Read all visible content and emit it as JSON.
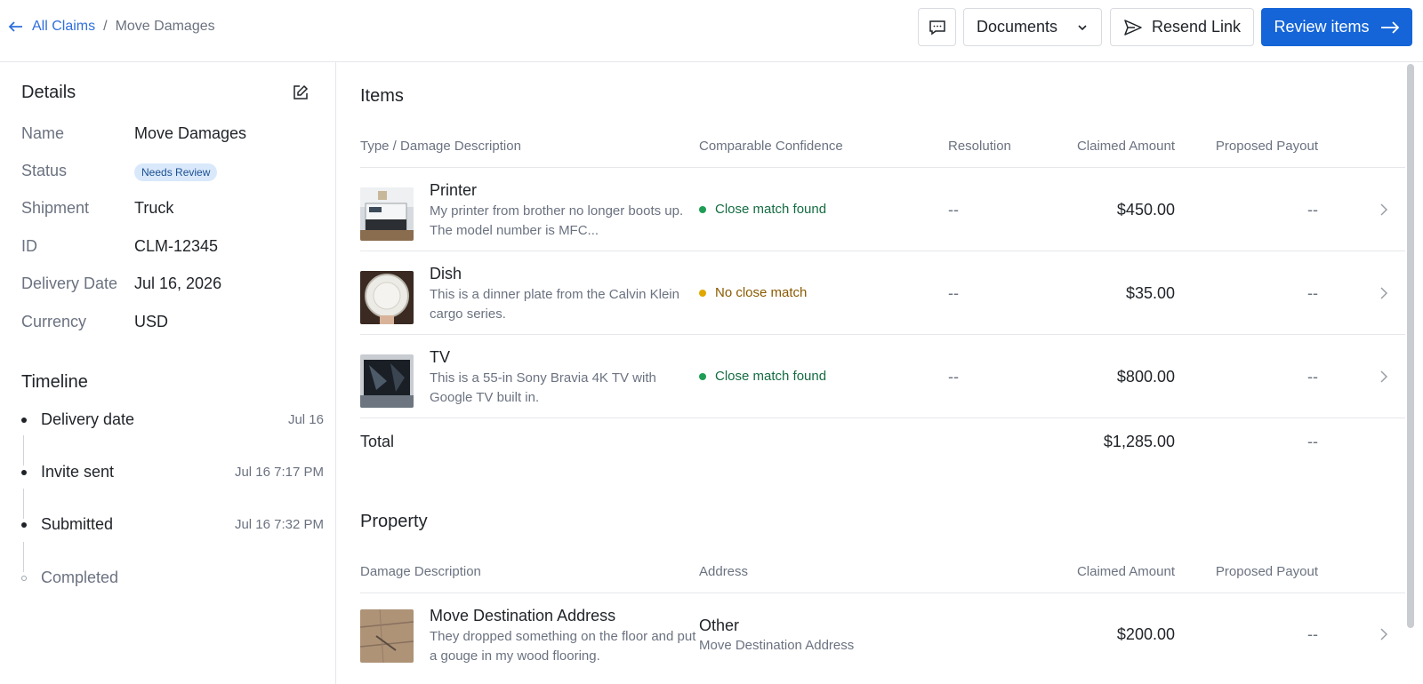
{
  "breadcrumb": {
    "back_link": "All Claims",
    "separator": "/",
    "current": "Move Damages"
  },
  "header": {
    "documents_label": "Documents",
    "resend_label": "Resend Link",
    "review_label": "Review items"
  },
  "details": {
    "title": "Details",
    "rows": [
      {
        "label": "Name",
        "value": "Move Damages"
      },
      {
        "label": "Status",
        "value": "Needs Review"
      },
      {
        "label": "Shipment",
        "value": "Truck"
      },
      {
        "label": "ID",
        "value": "CLM-12345"
      },
      {
        "label": "Delivery Date",
        "value": "Jul 16, 2026"
      },
      {
        "label": "Currency",
        "value": "USD"
      }
    ]
  },
  "timeline": {
    "title": "Timeline",
    "items": [
      {
        "label": "Delivery date",
        "date": "Jul 16",
        "done": true
      },
      {
        "label": "Invite sent",
        "date": "Jul 16 7:17 PM",
        "done": true
      },
      {
        "label": "Submitted",
        "date": "Jul 16 7:32 PM",
        "done": true
      },
      {
        "label": "Completed",
        "date": "",
        "done": false
      }
    ]
  },
  "items": {
    "title": "Items",
    "columns": [
      "Type / Damage Description",
      "Comparable Confidence",
      "Resolution",
      "Claimed Amount",
      "Proposed Payout"
    ],
    "rows": [
      {
        "name": "Printer",
        "description": "My printer from brother no longer boots up. The model number is MFC...",
        "confidence": "Close match found",
        "confidence_color": "#1f9d55",
        "resolution": "--",
        "claimed": "$450.00",
        "payout": "--"
      },
      {
        "name": "Dish",
        "description": "This is a dinner plate from the Calvin Klein cargo series.",
        "confidence": "No close match",
        "confidence_color": "#e0a800",
        "resolution": "--",
        "claimed": "$35.00",
        "payout": "--"
      },
      {
        "name": "TV",
        "description": "This is a 55-in Sony Bravia 4K TV with Google TV built in.",
        "confidence": "Close match found",
        "confidence_color": "#1f9d55",
        "resolution": "--",
        "claimed": "$800.00",
        "payout": "--"
      }
    ],
    "total_label": "Total",
    "total_claimed": "$1,285.00",
    "total_payout": "--"
  },
  "property": {
    "title": "Property",
    "columns": [
      "Damage Description",
      "Address",
      "Claimed Amount",
      "Proposed Payout"
    ],
    "rows": [
      {
        "name": "Move Destination Address",
        "description": "They dropped something on the floor and put a gouge in my wood flooring.",
        "address_type": "Other",
        "address": "Move Destination Address",
        "claimed": "$200.00",
        "payout": "--"
      }
    ]
  },
  "colors": {
    "primary": "#1565d8",
    "link": "#2f6fdb",
    "success": "#1f9d55",
    "warning": "#e0a800",
    "badge_bg": "#d9e9fb"
  }
}
